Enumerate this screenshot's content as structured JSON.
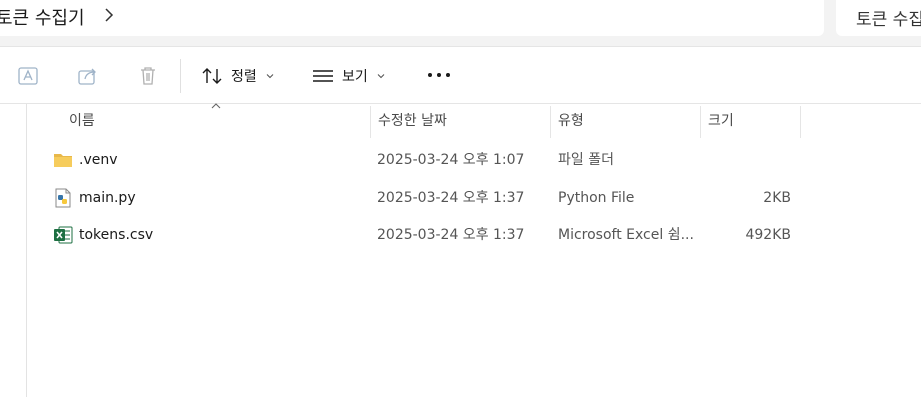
{
  "address": {
    "breadcrumb": "토큰 수집기",
    "search_text": "토큰 수집"
  },
  "toolbar": {
    "sort_label": "정렬",
    "view_label": "보기"
  },
  "columns": {
    "name": "이름",
    "modified": "수정한 날짜",
    "type": "유형",
    "size": "크기"
  },
  "files": [
    {
      "name": ".venv",
      "modified": "2025-03-24 오후 1:07",
      "type": "파일 폴더",
      "size": "",
      "icon": "folder-icon"
    },
    {
      "name": "main.py",
      "modified": "2025-03-24 오후 1:37",
      "type": "Python File",
      "size": "2KB",
      "icon": "python-file-icon"
    },
    {
      "name": "tokens.csv",
      "modified": "2025-03-24 오후 1:37",
      "type": "Microsoft Excel 쉼...",
      "size": "492KB",
      "icon": "excel-file-icon"
    }
  ]
}
